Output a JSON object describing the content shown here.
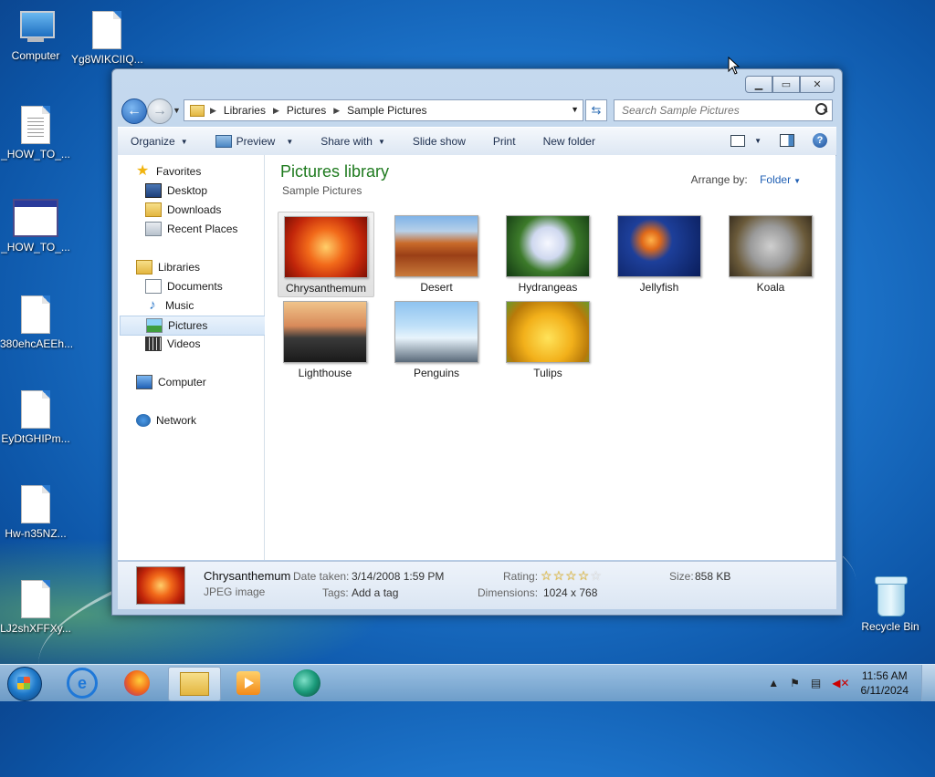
{
  "desktop": {
    "icons": [
      {
        "label": "Computer"
      },
      {
        "label": "Yg8WIKCIIQ..."
      },
      {
        "label": "_HOW_TO_..."
      },
      {
        "label": "_HOW_TO_..."
      },
      {
        "label": "380ehcAEEh..."
      },
      {
        "label": "EyDtGHIPm..."
      },
      {
        "label": "Hw-n35NZ..."
      },
      {
        "label": "LJ2shXFFXy..."
      },
      {
        "label": "Recycle Bin"
      }
    ]
  },
  "window": {
    "address": {
      "crumbs": [
        "Libraries",
        "Pictures",
        "Sample Pictures"
      ],
      "search_placeholder": "Search Sample Pictures"
    },
    "toolbar": {
      "organize": "Organize",
      "preview": "Preview",
      "share_with": "Share with",
      "slide_show": "Slide show",
      "print": "Print",
      "new_folder": "New folder",
      "help": "?"
    },
    "nav": {
      "favorites": "Favorites",
      "desktop": "Desktop",
      "downloads": "Downloads",
      "recent_places": "Recent Places",
      "libraries": "Libraries",
      "documents": "Documents",
      "music": "Music",
      "pictures": "Pictures",
      "videos": "Videos",
      "computer": "Computer",
      "network": "Network"
    },
    "content": {
      "title": "Pictures library",
      "subtitle": "Sample Pictures",
      "arrange_label": "Arrange by:",
      "arrange_value": "Folder",
      "files": [
        {
          "name": "Chrysanthemum",
          "selected": true
        },
        {
          "name": "Desert"
        },
        {
          "name": "Hydrangeas"
        },
        {
          "name": "Jellyfish"
        },
        {
          "name": "Koala"
        },
        {
          "name": "Lighthouse"
        },
        {
          "name": "Penguins"
        },
        {
          "name": "Tulips"
        }
      ]
    },
    "details": {
      "name": "Chrysanthemum",
      "type": "JPEG image",
      "date_taken_label": "Date taken:",
      "date_taken": "3/14/2008 1:59 PM",
      "tags_label": "Tags:",
      "tags": "Add a tag",
      "rating_label": "Rating:",
      "rating": 0,
      "rating_max": 5,
      "dimensions_label": "Dimensions:",
      "dimensions": "1024 x 768",
      "size_label": "Size:",
      "size": "858 KB"
    }
  },
  "taskbar": {
    "time": "11:56 AM",
    "date": "6/11/2024"
  }
}
